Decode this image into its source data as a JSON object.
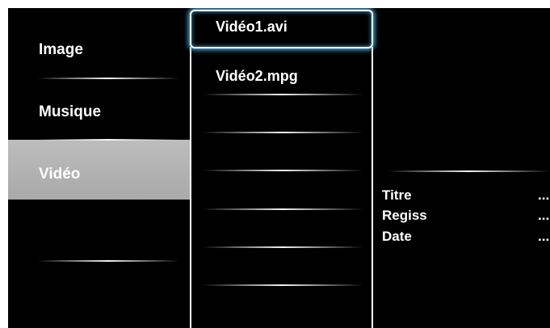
{
  "categories": [
    {
      "label": "Image",
      "selected": false
    },
    {
      "label": "Musique",
      "selected": false
    },
    {
      "label": "Vidéo",
      "selected": true
    }
  ],
  "files": [
    {
      "label": "Vidéo1.avi",
      "focused": true
    },
    {
      "label": "Vidéo2.mpg",
      "focused": false
    }
  ],
  "info": [
    {
      "label": "Titre",
      "value": "..."
    },
    {
      "label": "Regiss",
      "value": "..."
    },
    {
      "label": "Date",
      "value": "..."
    }
  ],
  "colors": {
    "background": "#000000",
    "text": "#ffffff",
    "selected_category": "#b4b4b4",
    "focus_glow": "#5ac8ff"
  }
}
